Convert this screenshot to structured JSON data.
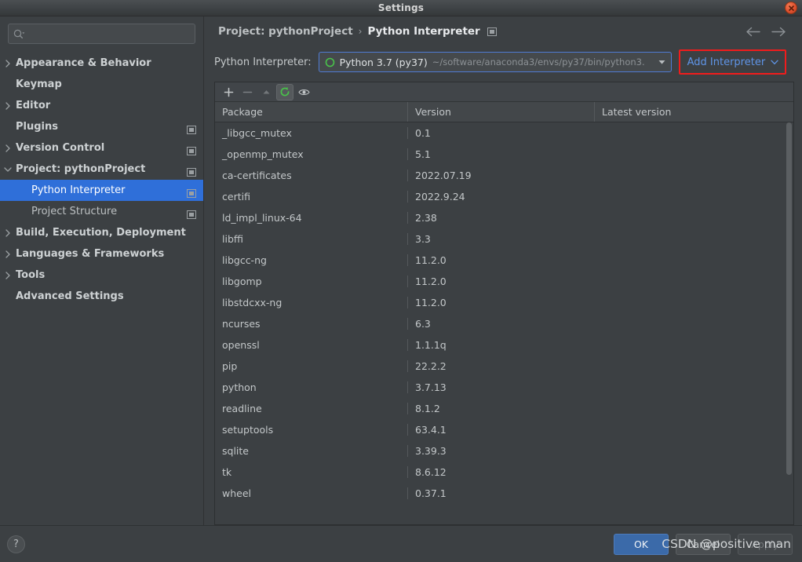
{
  "window": {
    "title": "Settings",
    "close_icon": "close-icon"
  },
  "sidebar": {
    "search": {
      "placeholder": "",
      "value": "",
      "icon": "search-icon"
    },
    "items": [
      {
        "label": "Appearance & Behavior",
        "expandable": true,
        "expanded": false,
        "child": false,
        "module": false,
        "selected": false
      },
      {
        "label": "Keymap",
        "expandable": false,
        "expanded": false,
        "child": false,
        "module": false,
        "selected": false
      },
      {
        "label": "Editor",
        "expandable": true,
        "expanded": false,
        "child": false,
        "module": false,
        "selected": false
      },
      {
        "label": "Plugins",
        "expandable": false,
        "expanded": false,
        "child": false,
        "module": true,
        "selected": false
      },
      {
        "label": "Version Control",
        "expandable": true,
        "expanded": false,
        "child": false,
        "module": true,
        "selected": false
      },
      {
        "label": "Project: pythonProject",
        "expandable": true,
        "expanded": true,
        "child": false,
        "module": true,
        "selected": false
      },
      {
        "label": "Python Interpreter",
        "expandable": false,
        "expanded": false,
        "child": true,
        "module": true,
        "selected": true
      },
      {
        "label": "Project Structure",
        "expandable": false,
        "expanded": false,
        "child": true,
        "module": true,
        "selected": false
      },
      {
        "label": "Build, Execution, Deployment",
        "expandable": true,
        "expanded": false,
        "child": false,
        "module": false,
        "selected": false
      },
      {
        "label": "Languages & Frameworks",
        "expandable": true,
        "expanded": false,
        "child": false,
        "module": false,
        "selected": false
      },
      {
        "label": "Tools",
        "expandable": true,
        "expanded": false,
        "child": false,
        "module": false,
        "selected": false
      },
      {
        "label": "Advanced Settings",
        "expandable": false,
        "expanded": false,
        "child": false,
        "module": false,
        "selected": false
      }
    ]
  },
  "breadcrumb": {
    "parent": "Project: pythonProject",
    "separator": "›",
    "current": "Python Interpreter",
    "module_icon": "module-icon",
    "back_icon": "arrow-left-icon",
    "forward_icon": "arrow-right-icon"
  },
  "interpreter": {
    "label": "Python Interpreter:",
    "selected_name": "Python 3.7 (py37)",
    "selected_path": "~/software/anaconda3/envs/py37/bin/python3.",
    "dropdown_icon": "chevron-down-icon",
    "python_icon": "python-ring-icon",
    "add_interpreter_label": "Add Interpreter",
    "add_interpreter_arrow_icon": "chevron-down-icon",
    "highlight_color": "#f01c1c",
    "link_color": "#5f95e8"
  },
  "packages_toolbar": {
    "buttons": [
      {
        "name": "add-package-button",
        "icon": "plus-icon",
        "state": "enabled"
      },
      {
        "name": "remove-package-button",
        "icon": "minus-icon",
        "state": "dim"
      },
      {
        "name": "upgrade-package-button",
        "icon": "arrow-up-icon",
        "state": "dim"
      },
      {
        "name": "refresh-packages-button",
        "icon": "refresh-green-icon",
        "state": "selected"
      },
      {
        "name": "show-early-releases-button",
        "icon": "eye-icon",
        "state": "enabled"
      }
    ]
  },
  "packages_table": {
    "columns": [
      "Package",
      "Version",
      "Latest version"
    ],
    "rows": [
      {
        "package": "_libgcc_mutex",
        "version": "0.1",
        "latest": ""
      },
      {
        "package": "_openmp_mutex",
        "version": "5.1",
        "latest": ""
      },
      {
        "package": "ca-certificates",
        "version": "2022.07.19",
        "latest": ""
      },
      {
        "package": "certifi",
        "version": "2022.9.24",
        "latest": ""
      },
      {
        "package": "ld_impl_linux-64",
        "version": "2.38",
        "latest": ""
      },
      {
        "package": "libffi",
        "version": "3.3",
        "latest": ""
      },
      {
        "package": "libgcc-ng",
        "version": "11.2.0",
        "latest": ""
      },
      {
        "package": "libgomp",
        "version": "11.2.0",
        "latest": ""
      },
      {
        "package": "libstdcxx-ng",
        "version": "11.2.0",
        "latest": ""
      },
      {
        "package": "ncurses",
        "version": "6.3",
        "latest": ""
      },
      {
        "package": "openssl",
        "version": "1.1.1q",
        "latest": ""
      },
      {
        "package": "pip",
        "version": "22.2.2",
        "latest": ""
      },
      {
        "package": "python",
        "version": "3.7.13",
        "latest": ""
      },
      {
        "package": "readline",
        "version": "8.1.2",
        "latest": ""
      },
      {
        "package": "setuptools",
        "version": "63.4.1",
        "latest": ""
      },
      {
        "package": "sqlite",
        "version": "3.39.3",
        "latest": ""
      },
      {
        "package": "tk",
        "version": "8.6.12",
        "latest": ""
      },
      {
        "package": "wheel",
        "version": "0.37.1",
        "latest": ""
      }
    ]
  },
  "footer": {
    "help_label": "?",
    "ok_label": "OK",
    "cancel_label": "Cancel",
    "apply_label": "Apply",
    "watermark": "CSDN @positive man"
  }
}
